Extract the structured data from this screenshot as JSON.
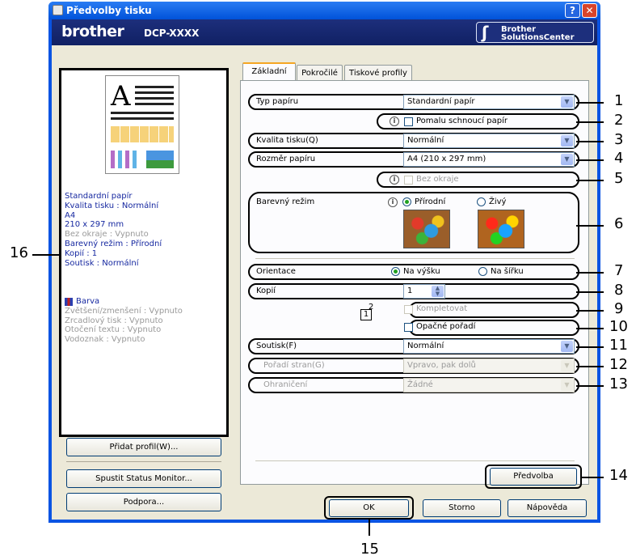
{
  "window": {
    "title": "Předvolby tisku",
    "help": "?",
    "close": "✕"
  },
  "brand": {
    "logo": "brother",
    "model": "DCP-XXXX",
    "solutions_line1": "Brother",
    "solutions_line2": "SolutionsCenter"
  },
  "tabs": [
    "Základní",
    "Pokročilé",
    "Tiskové profily"
  ],
  "fields": {
    "paper_type": {
      "label": "Typ papíru",
      "value": "Standardní papír"
    },
    "slow_dry": {
      "label": "Pomalu schnoucí papír"
    },
    "quality": {
      "label": "Kvalita tisku(Q)",
      "value": "Normální"
    },
    "paper_size": {
      "label": "Rozměr papíru",
      "value": "A4 (210 x 297 mm)"
    },
    "borderless": {
      "label": "Bez okraje"
    },
    "color_mode": {
      "label": "Barevný režim",
      "opt1": "Přírodní",
      "opt2": "Živý"
    },
    "orientation": {
      "label": "Orientace",
      "opt1": "Na výšku",
      "opt2": "Na šířku"
    },
    "copies": {
      "label": "Kopií",
      "value": "1"
    },
    "collate": {
      "label": "Kompletovat"
    },
    "reverse": {
      "label": "Opačné pořadí"
    },
    "multipage": {
      "label": "Soutisk(F)",
      "value": "Normální"
    },
    "page_order": {
      "label": "Pořadí stran(G)",
      "value": "Vpravo, pak dolů"
    },
    "border_line": {
      "label": "Ohraničení",
      "value": "Žádné"
    }
  },
  "buttons": {
    "default": "Předvolba",
    "ok": "OK",
    "cancel": "Storno",
    "help": "Nápověda",
    "add_profile": "Přidat profil(W)...",
    "status_monitor": "Spustit Status Monitor...",
    "support": "Podpora..."
  },
  "summary": [
    {
      "text": "Standardní papír",
      "gray": false
    },
    {
      "text": "Kvalita tisku : Normální",
      "gray": false
    },
    {
      "text": "A4",
      "gray": false
    },
    {
      "text": "210 x 297 mm",
      "gray": false
    },
    {
      "text": "Bez okraje : Vypnuto",
      "gray": true
    },
    {
      "text": "Barevný režim : Přírodní",
      "gray": false
    },
    {
      "text": "Kopií : 1",
      "gray": false
    },
    {
      "text": "Soutisk : Normální",
      "gray": false
    }
  ],
  "summary2": [
    {
      "text": "Barva",
      "gray": false
    },
    {
      "text": "Zvětšení/zmenšení : Vypnuto",
      "gray": true
    },
    {
      "text": "Zrcadlový tisk : Vypnuto",
      "gray": true
    },
    {
      "text": "Otočení textu : Vypnuto",
      "gray": true
    },
    {
      "text": "Vodoznak : Vypnuto",
      "gray": true
    }
  ],
  "preview_glyph": "A",
  "pages_glyph": {
    "a": "1",
    "b": "2"
  },
  "callouts": [
    "1",
    "2",
    "3",
    "4",
    "5",
    "6",
    "7",
    "8",
    "9",
    "10",
    "11",
    "12",
    "13",
    "14",
    "15",
    "16"
  ],
  "colors": {
    "title_blue": "#0a54e3",
    "brand_navy": "#1d2f7c",
    "panel_bg": "#ece9d8",
    "summary_text": "#1628a0"
  }
}
